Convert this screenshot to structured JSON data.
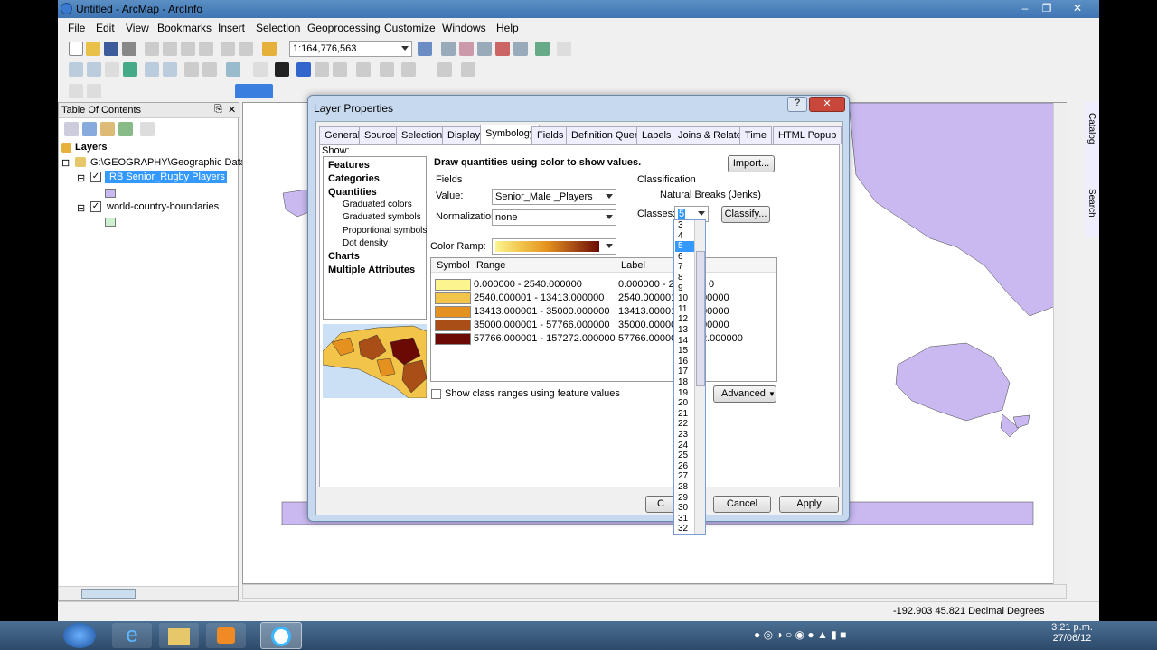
{
  "window": {
    "title": "Untitled - ArcMap - ArcInfo"
  },
  "menu": [
    "File",
    "Edit",
    "View",
    "Bookmarks",
    "Insert",
    "Selection",
    "Geoprocessing",
    "Customize",
    "Windows",
    "Help"
  ],
  "toolbar": {
    "scale": "1:164,776,563"
  },
  "toc": {
    "title": "Table Of Contents",
    "root": "Layers",
    "group": "G:\\GEOGRAPHY\\Geographic Data",
    "layer1": "IRB Senior_Rugby Players",
    "layer2": "world-country-boundaries"
  },
  "side_tabs": [
    "Catalog",
    "Search"
  ],
  "dialog": {
    "title": "Layer Properties",
    "tabs": [
      "General",
      "Source",
      "Selection",
      "Display",
      "Symbology",
      "Fields",
      "Definition Query",
      "Labels",
      "Joins & Relates",
      "Time",
      "HTML Popup"
    ],
    "active_tab": "Symbology",
    "show_label": "Show:",
    "show_items": {
      "features": "Features",
      "categories": "Categories",
      "quantities": "Quantities",
      "graduated_colors": "Graduated colors",
      "graduated_symbols": "Graduated symbols",
      "proportional_symbols": "Proportional symbols",
      "dot_density": "Dot density",
      "charts": "Charts",
      "multiple_attributes": "Multiple Attributes"
    },
    "heading": "Draw quantities using color to show values.",
    "import_label": "Import...",
    "fields_label": "Fields",
    "value_label": "Value:",
    "value": "Senior_Male _Players",
    "normalization_label": "Normalization:",
    "normalization": "none",
    "classification_label": "Classification",
    "method": "Natural Breaks (Jenks)",
    "classes_label": "Classes:",
    "classes_value": "5",
    "classify_label": "Classify...",
    "color_ramp_label": "Color Ramp:",
    "col_symbol": "Symbol",
    "col_range": "Range",
    "col_label": "Label",
    "classes": [
      {
        "range": "0.000000 - 2540.000000",
        "label": "0.000000 - 25",
        "color": "#fbf48f"
      },
      {
        "range": "2540.000001 - 13413.000000",
        "label": "2540.000001 -",
        "color": "#f2c44a"
      },
      {
        "range": "13413.000001 - 35000.000000",
        "label": "13413.00001",
        "color": "#e4911f"
      },
      {
        "range": "35000.000001 - 57766.000000",
        "label": "35000.000001",
        "color": "#a84e16"
      },
      {
        "range": "57766.000001 - 157272.000000",
        "label": "57766.000001",
        "color": "#6b0a05"
      }
    ],
    "label_tails": [
      "0",
      "00000",
      "00000",
      "00000",
      "2.000000"
    ],
    "show_ranges_label": "Show class ranges using feature values",
    "advanced_label": "Advanced",
    "ok_label": "C",
    "cancel_label": "Cancel",
    "apply_label": "Apply",
    "class_options": [
      "3",
      "4",
      "5",
      "6",
      "7",
      "8",
      "9",
      "10",
      "11",
      "12",
      "13",
      "14",
      "15",
      "16",
      "17",
      "18",
      "19",
      "20",
      "21",
      "22",
      "23",
      "24",
      "25",
      "26",
      "27",
      "28",
      "29",
      "30",
      "31",
      "32"
    ]
  },
  "status": {
    "coords": "-192.903  45.821 Decimal Degrees"
  },
  "clock": {
    "time": "3:21 p.m.",
    "date": "27/06/12"
  }
}
